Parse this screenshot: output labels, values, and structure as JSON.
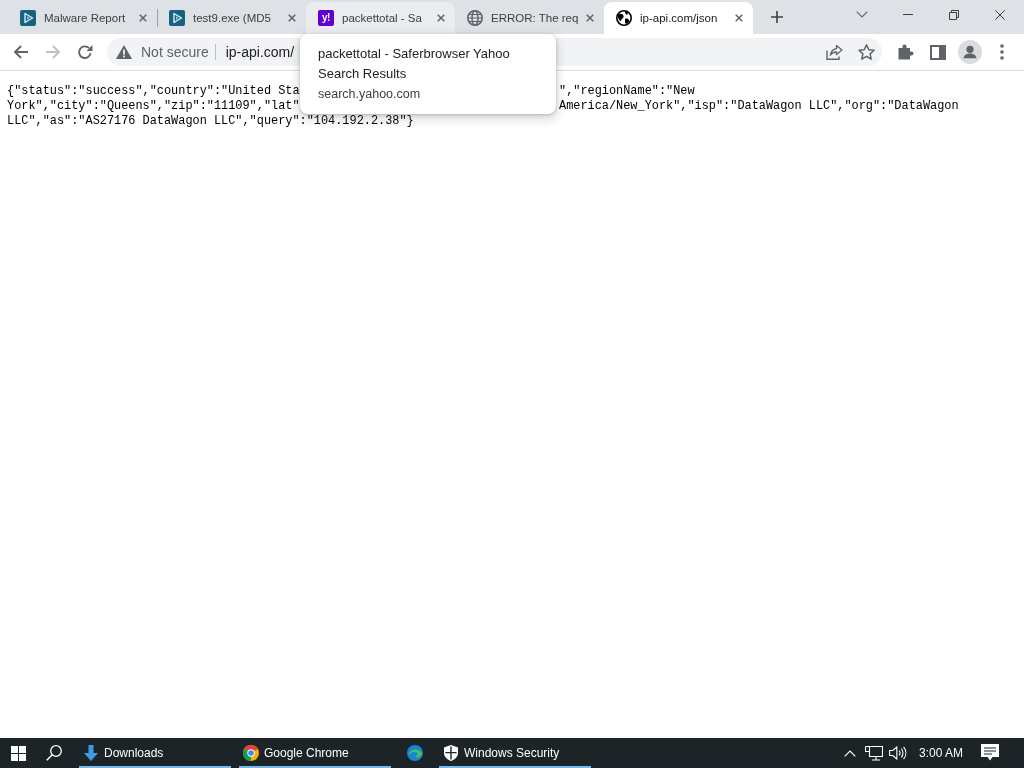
{
  "browser": {
    "tabs": [
      {
        "kind": "play",
        "title": "Malware Report",
        "selected": false,
        "hovered": false
      },
      {
        "kind": "play",
        "title": "test9.exe (MD5",
        "selected": false,
        "hovered": false
      },
      {
        "kind": "letters",
        "icon_text": "y!",
        "title": "packettotal - Sa",
        "selected": false,
        "hovered": true
      },
      {
        "kind": "globe",
        "title": "ERROR: The req",
        "selected": false,
        "hovered": false
      },
      {
        "kind": "earth",
        "title": "ip-api.com/json",
        "selected": true,
        "hovered": false
      }
    ],
    "hover_card": {
      "title": "packettotal - Saferbrowser Yahoo Search Results",
      "url": "search.yahoo.com"
    },
    "toolbar": {
      "nav": [
        {
          "kind": "back",
          "disabled": false
        },
        {
          "kind": "forward",
          "disabled": true
        },
        {
          "kind": "reload",
          "disabled": false
        }
      ],
      "security": "Not secure",
      "url": "ip-api.com/"
    }
  },
  "page": {
    "lines": [
      {
        "segments": [
          "{\"status\":\"success\",\"country\":\"United Sta",
          "\",\"regionName\":\"New"
        ]
      },
      {
        "segments": [
          "York\",\"city\":\"Queens\",\"zip\":\"11109\",\"lat\"",
          "America/New_York\",\"isp\":\"DataWagon LLC\",\"org\":\"DataWagon"
        ]
      },
      {
        "segments": [
          "LLC\",\"as\":\"AS27176 DataWagon LLC\",\"query\":\"104.192.2.38\"}"
        ]
      }
    ]
  },
  "taskbar": {
    "buttons": [
      {
        "kind": "download",
        "label": "Downloads",
        "open": true
      },
      {
        "kind": "chrome",
        "label": "Google Chrome",
        "open": true
      },
      {
        "kind": "edge",
        "open": false
      },
      {
        "kind": "shield",
        "label": "Windows Security",
        "open": true
      }
    ],
    "clock": "3:00 AM"
  }
}
